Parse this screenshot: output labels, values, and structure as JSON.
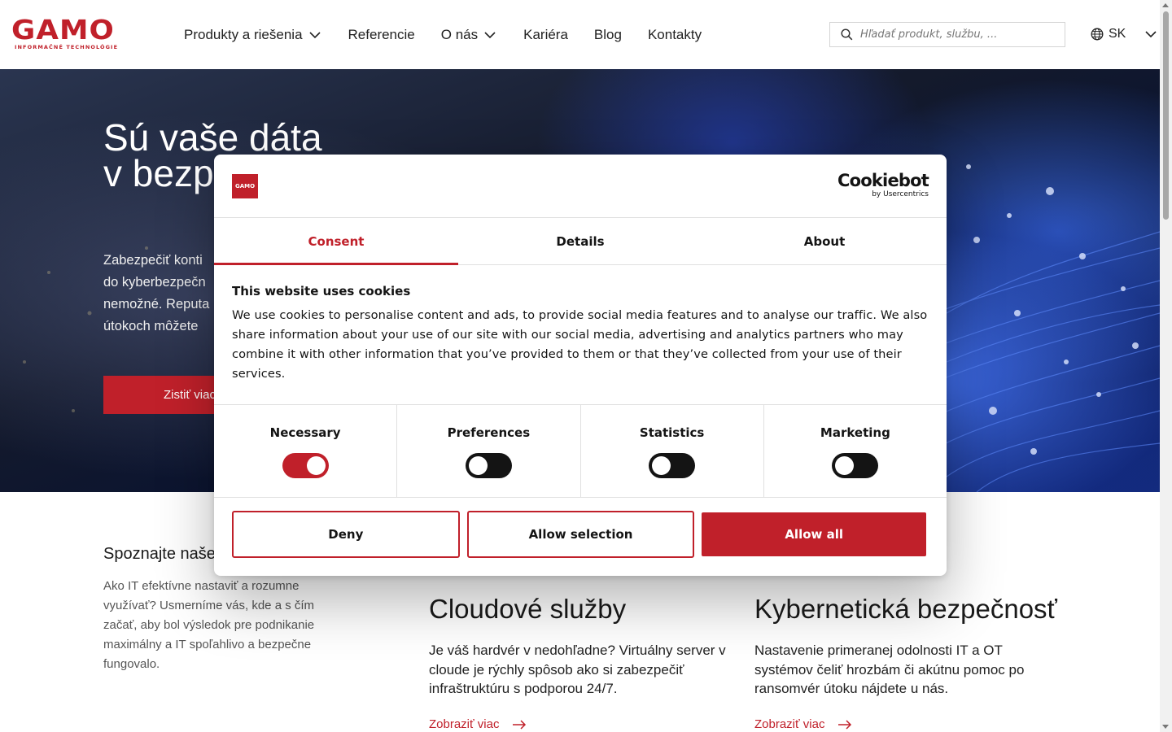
{
  "header": {
    "logo_text": "GAMO",
    "logo_subtitle": "INFORMAČNÉ TECHNOLÓGIE",
    "nav": [
      {
        "label": "Produkty a riešenia",
        "has_dropdown": true
      },
      {
        "label": "Referencie",
        "has_dropdown": false
      },
      {
        "label": "O nás",
        "has_dropdown": true
      },
      {
        "label": "Kariéra",
        "has_dropdown": false
      },
      {
        "label": "Blog",
        "has_dropdown": false
      },
      {
        "label": "Kontakty",
        "has_dropdown": false
      }
    ],
    "search_placeholder": "Hľadať produkt, službu, ...",
    "language": "SK",
    "icons": {
      "search": "search-icon",
      "language": "globe-icon",
      "dropdown": "chevron-down-icon"
    }
  },
  "hero": {
    "title_line1": "Sú vaše dáta",
    "title_line2": "v bezp",
    "text_lines": [
      "Zabezpečiť konti",
      "do kyberbezpečn",
      "nemožné. Reputa",
      "útokoch môžete "
    ],
    "button_label": "Zistiť viac"
  },
  "intro": {
    "title": "Spoznajte naše",
    "text": "Ako IT efektívne nastaviť a rozumne využívať? Usmerníme vás, kde a s čím začať, aby bol výsledok pre podnikanie maximálny a IT spoľahlivo a bezpečne fungovalo."
  },
  "cards": [
    {
      "title": "Cloudové služby",
      "text": "Je váš hardvér v nedohľadne? Virtuálny server v cloude je rýchly spôsob ako si zabezpečiť infraštruktúru s podporou 24/7.",
      "link": "Zobraziť viac"
    },
    {
      "title": "Kybernetická bezpečnosť",
      "text": "Nastavenie primeranej odolnosti IT a OT systémov čeliť hrozbám či akútnu pomoc po ransomvér útoku nájdete u nás.",
      "link": "Zobraziť viac"
    }
  ],
  "cookie_dialog": {
    "logo_text": "GAMO",
    "brand": "Cookiebot",
    "brand_by": "by Usercentrics",
    "tabs": [
      {
        "label": "Consent",
        "active": true
      },
      {
        "label": "Details",
        "active": false
      },
      {
        "label": "About",
        "active": false
      }
    ],
    "heading": "This website uses cookies",
    "body": "We use cookies to personalise content and ads, to provide social media features and to analyse our traffic. We also share information about your use of our site with our social media, advertising and analytics partners who may combine it with other information that you’ve provided to them or that they’ve collected from your use of their services.",
    "toggles": [
      {
        "label": "Necessary",
        "on": true
      },
      {
        "label": "Preferences",
        "on": false
      },
      {
        "label": "Statistics",
        "on": false
      },
      {
        "label": "Marketing",
        "on": false
      }
    ],
    "buttons": {
      "deny": "Deny",
      "allow_selection": "Allow selection",
      "allow_all": "Allow all"
    }
  },
  "colors": {
    "brand": "#c0202a",
    "text": "#141414"
  }
}
